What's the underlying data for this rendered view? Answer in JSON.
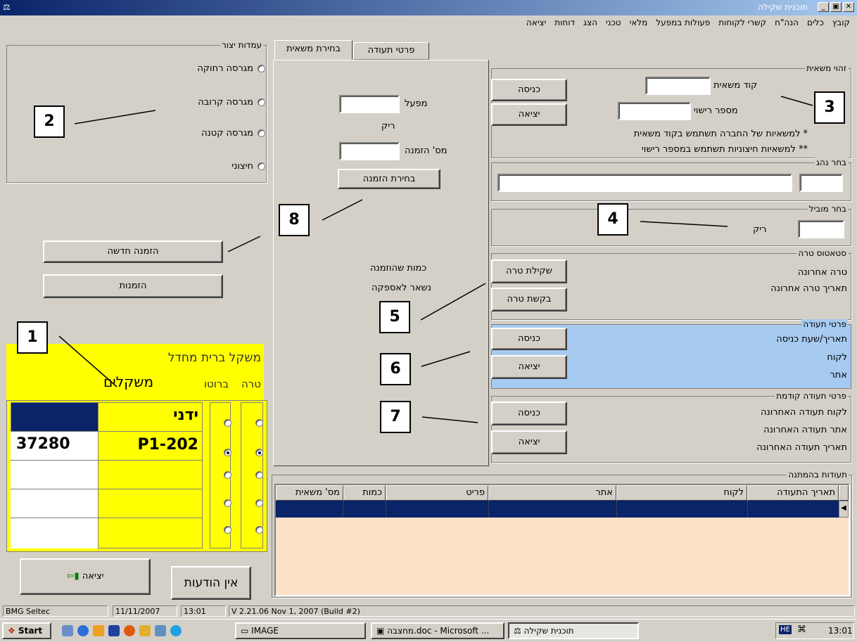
{
  "window": {
    "title": "תוכנית שקילה",
    "buttons": {
      "close": "✕",
      "maximize": "▣",
      "minimize": "_"
    }
  },
  "menu": [
    "קובץ",
    "כלים",
    "הנה\"ח",
    "קשרי לקוחות",
    "פעולות במפעל",
    "מלאי",
    "טכני",
    "הצג",
    "דוחות",
    "יציאה"
  ],
  "tabs": {
    "truck_select": "בחירת משאית",
    "doc_details": "פרטי תעודה"
  },
  "stations": {
    "legend": "עמדות יצור",
    "items": [
      "מגרסה רחוקה",
      "מגרסה קרובה",
      "מגרסה קטנה",
      "חיצוני"
    ]
  },
  "truck_id": {
    "legend": "זהוי משאית",
    "code_label": "קוד משאית",
    "license_label": "מספר רישוי",
    "enter": "כניסה",
    "exit": "יציאה",
    "note1": "* למשאיות של החברה תשתמש בקוד משאית",
    "note2": "** למשאיות חיצוניות תשתמש במספר רישוי"
  },
  "driver": {
    "legend": "בחר נהג"
  },
  "carrier": {
    "legend": "בחר מוביל",
    "empty": "ריק"
  },
  "tare": {
    "legend": "סטאטוס טרה",
    "last": "טרה אחרונה",
    "last_date": "תאריך טרה אחרונה",
    "weigh": "שקילת טרה",
    "request": "בקשת טרה"
  },
  "doc": {
    "legend": "פרטי תעודה",
    "entry": "תאריך/שעת כניסה",
    "customer": "לקוח",
    "site": "אתר",
    "enter": "כניסה",
    "exit": "יציאה"
  },
  "prev_doc": {
    "legend": "פרטי תעודה קודמת",
    "customer": "לקוח תעודה האחרונה",
    "site": "אתר תעודה האחרונה",
    "date": "תאריך תעודה האחרונה",
    "enter": "כניסה",
    "exit": "יציאה"
  },
  "order": {
    "factory": "מפעל",
    "empty": "ריק",
    "order_no": "מס' הזמנה",
    "select": "בחירת הזמנה",
    "ordered_qty": "כמות שהוזמנה",
    "remaining": "נשאר לאספקה"
  },
  "left": {
    "new_order": "הזמנה חדשה",
    "orders": "הזמנות",
    "scale_name": "משקל ברית מחדל",
    "scales": "משקלים",
    "gross": "ברוטו",
    "tare": "טרה",
    "no_messages": "אין הודעות",
    "exit": "יציאה"
  },
  "scale_rows": [
    {
      "name": "ידני",
      "value": ""
    },
    {
      "name": "P1-202",
      "value": "37280"
    },
    {
      "name": "",
      "value": ""
    },
    {
      "name": "",
      "value": ""
    },
    {
      "name": "",
      "value": ""
    }
  ],
  "waiting": {
    "legend": "תעודות בהמתנה",
    "columns": [
      "תאריך התעודה",
      "לקוח",
      "אתר",
      "פריט",
      "כמות",
      "מס' משאית"
    ]
  },
  "statusbar": {
    "company": "BMG Seltec",
    "date": "11/11/2007",
    "time": "13:01",
    "version": "V 2.21.06 Nov 1, 2007 (Build #2)"
  },
  "taskbar": {
    "start": "Start",
    "tasks": [
      "IMAGE",
      "מחצבה.doc - Microsoft ...",
      "תוכנית שקילה"
    ],
    "clock": "13:01",
    "lang": "HE"
  },
  "callouts": [
    "1",
    "2",
    "3",
    "4",
    "5",
    "6",
    "7",
    "8"
  ]
}
